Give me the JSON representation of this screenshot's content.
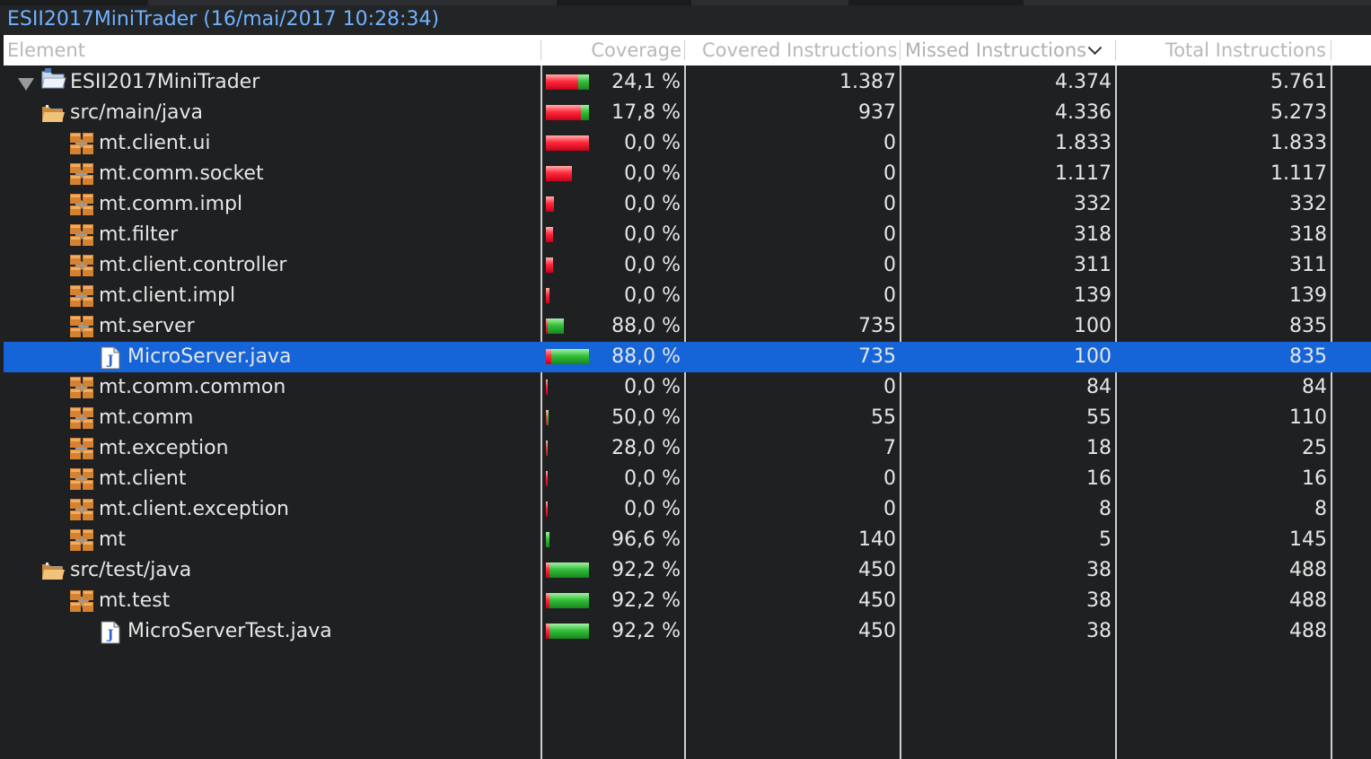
{
  "window_title": "ESII2017MiniTrader (16/mai/2017 10:28:34)",
  "columns": {
    "element": "Element",
    "coverage": "Coverage",
    "covered": "Covered Instructions",
    "missed": "Missed Instructions",
    "total": "Total Instructions"
  },
  "sort_icon": "chevron-down-icon",
  "colors": {
    "bar_red": "#ff2c3c",
    "bar_green": "#34c03c",
    "selection": "#1565d8",
    "title": "#6fb3ff"
  },
  "rows": [
    {
      "name": "ESII2017MiniTrader",
      "type": "project",
      "indent": 0,
      "toggle": "expanded",
      "coverage": "24,1 %",
      "covered": "1.387",
      "missed": "4.374",
      "total": "5.761",
      "bar_total": 5761,
      "bar_covered": 1387
    },
    {
      "name": "src/main/java",
      "type": "folder",
      "indent": 1,
      "toggle": "expanded",
      "coverage": "17,8 %",
      "covered": "937",
      "missed": "4.336",
      "total": "5.273",
      "bar_total": 5273,
      "bar_covered": 937
    },
    {
      "name": "mt.client.ui",
      "type": "package",
      "indent": 2,
      "toggle": "collapsed",
      "coverage": "0,0 %",
      "covered": "0",
      "missed": "1.833",
      "total": "1.833",
      "bar_total": 1833,
      "bar_covered": 0
    },
    {
      "name": "mt.comm.socket",
      "type": "package",
      "indent": 2,
      "toggle": "collapsed",
      "coverage": "0,0 %",
      "covered": "0",
      "missed": "1.117",
      "total": "1.117",
      "bar_total": 1117,
      "bar_covered": 0
    },
    {
      "name": "mt.comm.impl",
      "type": "package",
      "indent": 2,
      "toggle": "collapsed",
      "coverage": "0,0 %",
      "covered": "0",
      "missed": "332",
      "total": "332",
      "bar_total": 332,
      "bar_covered": 0
    },
    {
      "name": "mt.filter",
      "type": "package",
      "indent": 2,
      "toggle": "collapsed",
      "coverage": "0,0 %",
      "covered": "0",
      "missed": "318",
      "total": "318",
      "bar_total": 318,
      "bar_covered": 0
    },
    {
      "name": "mt.client.controller",
      "type": "package",
      "indent": 2,
      "toggle": "collapsed",
      "coverage": "0,0 %",
      "covered": "0",
      "missed": "311",
      "total": "311",
      "bar_total": 311,
      "bar_covered": 0
    },
    {
      "name": "mt.client.impl",
      "type": "package",
      "indent": 2,
      "toggle": "collapsed",
      "coverage": "0,0 %",
      "covered": "0",
      "missed": "139",
      "total": "139",
      "bar_total": 139,
      "bar_covered": 0
    },
    {
      "name": "mt.server",
      "type": "package",
      "indent": 2,
      "toggle": "expanded",
      "coverage": "88,0 %",
      "covered": "735",
      "missed": "100",
      "total": "835",
      "bar_total": 835,
      "bar_covered": 735
    },
    {
      "name": "MicroServer.java",
      "type": "file",
      "indent": 3,
      "toggle": "collapsed",
      "coverage": "88,0 %",
      "covered": "735",
      "missed": "100",
      "total": "835",
      "bar_total": 835,
      "bar_covered": 735,
      "selected": true
    },
    {
      "name": "mt.comm.common",
      "type": "package",
      "indent": 2,
      "toggle": "collapsed",
      "coverage": "0,0 %",
      "covered": "0",
      "missed": "84",
      "total": "84",
      "bar_total": 84,
      "bar_covered": 0
    },
    {
      "name": "mt.comm",
      "type": "package",
      "indent": 2,
      "toggle": "collapsed",
      "coverage": "50,0 %",
      "covered": "55",
      "missed": "55",
      "total": "110",
      "bar_total": 110,
      "bar_covered": 55
    },
    {
      "name": "mt.exception",
      "type": "package",
      "indent": 2,
      "toggle": "collapsed",
      "coverage": "28,0 %",
      "covered": "7",
      "missed": "18",
      "total": "25",
      "bar_total": 25,
      "bar_covered": 7
    },
    {
      "name": "mt.client",
      "type": "package",
      "indent": 2,
      "toggle": "collapsed",
      "coverage": "0,0 %",
      "covered": "0",
      "missed": "16",
      "total": "16",
      "bar_total": 16,
      "bar_covered": 0
    },
    {
      "name": "mt.client.exception",
      "type": "package",
      "indent": 2,
      "toggle": "collapsed",
      "coverage": "0,0 %",
      "covered": "0",
      "missed": "8",
      "total": "8",
      "bar_total": 8,
      "bar_covered": 0
    },
    {
      "name": "mt",
      "type": "package",
      "indent": 2,
      "toggle": "collapsed",
      "coverage": "96,6 %",
      "covered": "140",
      "missed": "5",
      "total": "145",
      "bar_total": 145,
      "bar_covered": 140
    },
    {
      "name": "src/test/java",
      "type": "folder",
      "indent": 1,
      "toggle": "expanded",
      "coverage": "92,2 %",
      "covered": "450",
      "missed": "38",
      "total": "488",
      "bar_total": 488,
      "bar_covered": 450
    },
    {
      "name": "mt.test",
      "type": "package",
      "indent": 2,
      "toggle": "expanded",
      "coverage": "92,2 %",
      "covered": "450",
      "missed": "38",
      "total": "488",
      "bar_total": 488,
      "bar_covered": 450
    },
    {
      "name": "MicroServerTest.java",
      "type": "file",
      "indent": 3,
      "toggle": "collapsed",
      "coverage": "92,2 %",
      "covered": "450",
      "missed": "38",
      "total": "488",
      "bar_total": 488,
      "bar_covered": 450
    }
  ]
}
